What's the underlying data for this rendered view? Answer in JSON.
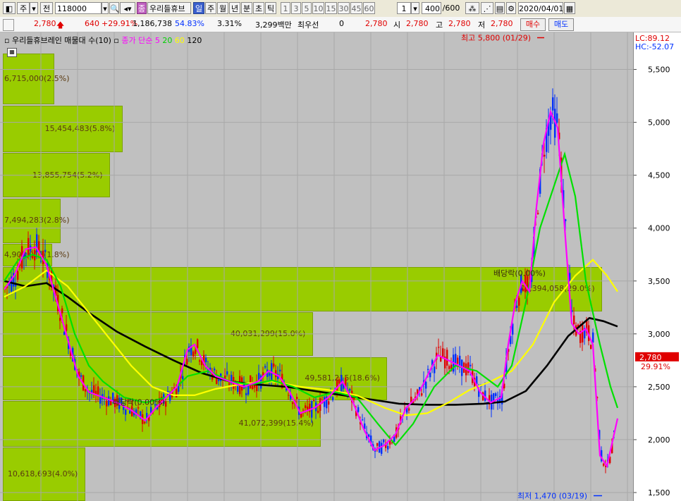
{
  "toolbar": {
    "market": "주",
    "period": "전",
    "code": "118000",
    "name": "우리들휴브",
    "intervals": [
      "일",
      "주",
      "월",
      "년",
      "분",
      "초",
      "틱"
    ],
    "selected_interval": "일",
    "numbers": [
      "1",
      "3",
      "5",
      "10",
      "15",
      "30",
      "45",
      "60"
    ],
    "unit": "1",
    "count": "400",
    "count_total": "/600",
    "date": "2020/04/01",
    "badge_label": "종"
  },
  "quote": {
    "price": "2,780",
    "change": "640",
    "change_pct": "+29.91%",
    "volume": "1,186,738",
    "ratio1": "54.83%",
    "ratio2": "3.31%",
    "amount": "3,299백만",
    "best_bid_label": "최우선",
    "best_bid": "0",
    "last": "2,780",
    "open_label": "시",
    "open": "2,780",
    "high_label": "고",
    "high": "2,780",
    "low_label": "저",
    "low": "2,780",
    "buy_label": "매수",
    "sell_label": "매도"
  },
  "chart_header": {
    "title": "우리들휴브레인 매물대 수(10)",
    "ma_label": "종가 단순",
    "ma_periods": [
      "5",
      "20",
      "60",
      "120"
    ],
    "lc": "LC:89.12",
    "hc": "HC:-52.07"
  },
  "colors": {
    "up": "#e00000",
    "down": "#0030ff",
    "ma5": "#ff00ff",
    "ma20": "#00e000",
    "ma60": "#ffff00",
    "ma120": "#000000",
    "volume_profile": "#99cc00"
  },
  "chart_data": {
    "type": "line",
    "title": "우리들휴브레인 매물대 수(10)",
    "ylim": [
      1420,
      5850
    ],
    "y_ticks": [
      "1,500",
      "2,000",
      "2,500",
      "3,000",
      "3,500",
      "4,000",
      "4,500",
      "5,000",
      "5,500"
    ],
    "y_tick_values": [
      1500,
      2000,
      2500,
      3000,
      3500,
      4000,
      4500,
      5000,
      5500
    ],
    "current_price_label": "2,780",
    "current_change_label": "29.91%",
    "current_price": 2780,
    "high_annotation": "최고 5,800 (01/29)",
    "low_annotation": "최저 1,470 (03/19)",
    "high_value": 5800,
    "low_value": 1470,
    "dividend_labels": [
      {
        "text": "배당락(0.00%)",
        "x": 180,
        "y": 2330
      },
      {
        "text": "배당락(0.00%)",
        "x": 720,
        "y": 3550
      }
    ],
    "volume_profile": [
      {
        "label": "6,715,000(2.5%)",
        "lo": 5170,
        "hi": 5650,
        "share": 2.5
      },
      {
        "label": "15,454,483(5.8%)",
        "lo": 4720,
        "hi": 5160,
        "share": 5.8
      },
      {
        "label": "13,855,754(5.2%)",
        "lo": 4290,
        "hi": 4710,
        "share": 5.2
      },
      {
        "label": "7,494,283(2.8%)",
        "lo": 3860,
        "hi": 4280,
        "share": 2.8
      },
      {
        "label": "4,903,013(1.8%)",
        "lo": 3640,
        "hi": 3850,
        "share": 1.8
      },
      {
        "label": "77,394,058(29.0%)",
        "lo": 3215,
        "hi": 3635,
        "share": 29.0
      },
      {
        "label": "40,031,299(15.0%)",
        "lo": 2790,
        "hi": 3205,
        "share": 15.0
      },
      {
        "label": "49,581,215(18.6%)",
        "lo": 2375,
        "hi": 2780,
        "share": 18.6
      },
      {
        "label": "41,072,399(15.4%)",
        "lo": 1935,
        "hi": 2365,
        "share": 15.4
      },
      {
        "label": "10,618,693(4.0%)",
        "lo": 1420,
        "hi": 1925,
        "share": 4.0
      }
    ],
    "series": [
      {
        "name": "5",
        "type": "ma",
        "values": [
          [
            0,
            3420
          ],
          [
            15,
            3560
          ],
          [
            30,
            3800
          ],
          [
            45,
            3820
          ],
          [
            60,
            3650
          ],
          [
            75,
            3300
          ],
          [
            90,
            2950
          ],
          [
            105,
            2600
          ],
          [
            120,
            2450
          ],
          [
            140,
            2400
          ],
          [
            160,
            2350
          ],
          [
            180,
            2280
          ],
          [
            200,
            2180
          ],
          [
            215,
            2300
          ],
          [
            230,
            2400
          ],
          [
            245,
            2500
          ],
          [
            260,
            2850
          ],
          [
            270,
            2900
          ],
          [
            285,
            2700
          ],
          [
            300,
            2600
          ],
          [
            320,
            2550
          ],
          [
            340,
            2500
          ],
          [
            360,
            2550
          ],
          [
            375,
            2650
          ],
          [
            390,
            2600
          ],
          [
            405,
            2450
          ],
          [
            420,
            2250
          ],
          [
            440,
            2300
          ],
          [
            460,
            2400
          ],
          [
            480,
            2550
          ],
          [
            495,
            2350
          ],
          [
            510,
            2100
          ],
          [
            525,
            1900
          ],
          [
            540,
            1950
          ],
          [
            555,
            2050
          ],
          [
            570,
            2300
          ],
          [
            585,
            2400
          ],
          [
            600,
            2600
          ],
          [
            615,
            2800
          ],
          [
            630,
            2750
          ],
          [
            645,
            2700
          ],
          [
            660,
            2650
          ],
          [
            675,
            2450
          ],
          [
            690,
            2350
          ],
          [
            705,
            2400
          ],
          [
            715,
            2900
          ],
          [
            725,
            3300
          ],
          [
            735,
            3500
          ],
          [
            745,
            3400
          ],
          [
            755,
            4200
          ],
          [
            765,
            4800
          ],
          [
            775,
            5100
          ],
          [
            785,
            4950
          ],
          [
            795,
            4000
          ],
          [
            805,
            3100
          ],
          [
            815,
            3000
          ],
          [
            825,
            3050
          ],
          [
            835,
            2900
          ],
          [
            845,
            1850
          ],
          [
            855,
            1750
          ],
          [
            865,
            2050
          ],
          [
            870,
            2200
          ]
        ]
      },
      {
        "name": "20",
        "type": "ma",
        "values": [
          [
            0,
            3500
          ],
          [
            20,
            3700
          ],
          [
            40,
            3750
          ],
          [
            60,
            3700
          ],
          [
            80,
            3450
          ],
          [
            100,
            3000
          ],
          [
            120,
            2700
          ],
          [
            140,
            2550
          ],
          [
            170,
            2400
          ],
          [
            200,
            2350
          ],
          [
            230,
            2400
          ],
          [
            260,
            2600
          ],
          [
            290,
            2650
          ],
          [
            320,
            2550
          ],
          [
            350,
            2520
          ],
          [
            380,
            2560
          ],
          [
            410,
            2500
          ],
          [
            440,
            2400
          ],
          [
            470,
            2450
          ],
          [
            500,
            2400
          ],
          [
            530,
            2150
          ],
          [
            555,
            1950
          ],
          [
            580,
            2150
          ],
          [
            610,
            2500
          ],
          [
            640,
            2700
          ],
          [
            670,
            2650
          ],
          [
            700,
            2500
          ],
          [
            720,
            2700
          ],
          [
            740,
            3300
          ],
          [
            760,
            4000
          ],
          [
            780,
            4400
          ],
          [
            795,
            4700
          ],
          [
            810,
            4300
          ],
          [
            825,
            3500
          ],
          [
            845,
            2900
          ],
          [
            860,
            2500
          ],
          [
            870,
            2300
          ]
        ]
      },
      {
        "name": "60",
        "type": "ma",
        "values": [
          [
            0,
            3350
          ],
          [
            30,
            3450
          ],
          [
            60,
            3600
          ],
          [
            90,
            3450
          ],
          [
            120,
            3200
          ],
          [
            150,
            2950
          ],
          [
            180,
            2700
          ],
          [
            210,
            2500
          ],
          [
            240,
            2420
          ],
          [
            270,
            2420
          ],
          [
            300,
            2480
          ],
          [
            340,
            2530
          ],
          [
            380,
            2550
          ],
          [
            420,
            2500
          ],
          [
            460,
            2470
          ],
          [
            500,
            2420
          ],
          [
            540,
            2300
          ],
          [
            570,
            2230
          ],
          [
            600,
            2250
          ],
          [
            630,
            2350
          ],
          [
            660,
            2470
          ],
          [
            690,
            2550
          ],
          [
            720,
            2650
          ],
          [
            750,
            2900
          ],
          [
            780,
            3300
          ],
          [
            810,
            3550
          ],
          [
            835,
            3700
          ],
          [
            855,
            3550
          ],
          [
            870,
            3400
          ]
        ]
      },
      {
        "name": "120",
        "type": "ma",
        "values": [
          [
            0,
            3500
          ],
          [
            30,
            3450
          ],
          [
            60,
            3480
          ],
          [
            90,
            3350
          ],
          [
            120,
            3200
          ],
          [
            160,
            3020
          ],
          [
            200,
            2880
          ],
          [
            240,
            2750
          ],
          [
            280,
            2630
          ],
          [
            320,
            2550
          ],
          [
            360,
            2520
          ],
          [
            400,
            2500
          ],
          [
            440,
            2460
          ],
          [
            480,
            2420
          ],
          [
            520,
            2380
          ],
          [
            560,
            2340
          ],
          [
            600,
            2330
          ],
          [
            640,
            2330
          ],
          [
            680,
            2340
          ],
          [
            710,
            2360
          ],
          [
            740,
            2460
          ],
          [
            770,
            2700
          ],
          [
            800,
            2980
          ],
          [
            830,
            3150
          ],
          [
            850,
            3120
          ],
          [
            870,
            3070
          ]
        ]
      }
    ]
  }
}
